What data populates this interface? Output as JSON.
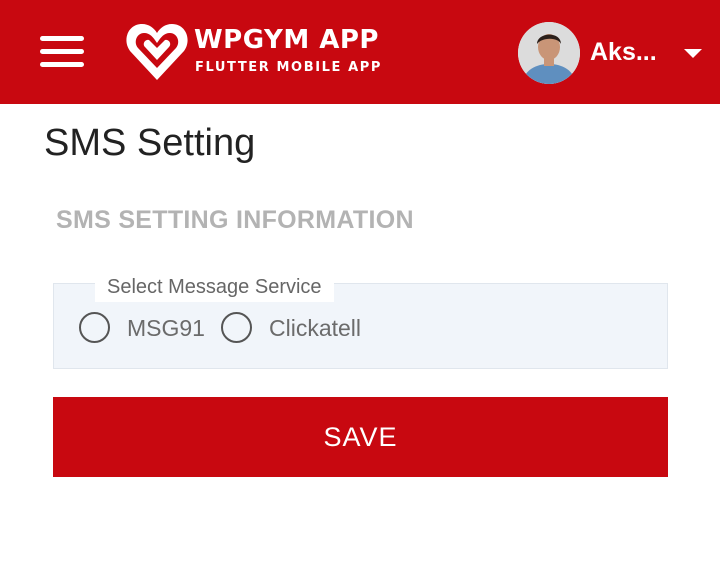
{
  "header": {
    "brand_title": "WPGYM APP",
    "brand_subtitle": "FLUTTER MOBILE APP",
    "user_name": "Aks...",
    "background_color": "#c80810",
    "menu_icon": "hamburger-menu-icon",
    "dropdown_icon": "caret-down-icon"
  },
  "page": {
    "title": "SMS Setting",
    "section_title": "SMS SETTING INFORMATION"
  },
  "form": {
    "group_label": "Select Message Service",
    "options": [
      {
        "label": "MSG91",
        "selected": false
      },
      {
        "label": "Clickatell",
        "selected": false
      }
    ],
    "save_label": "SAVE",
    "save_color": "#c80810"
  }
}
